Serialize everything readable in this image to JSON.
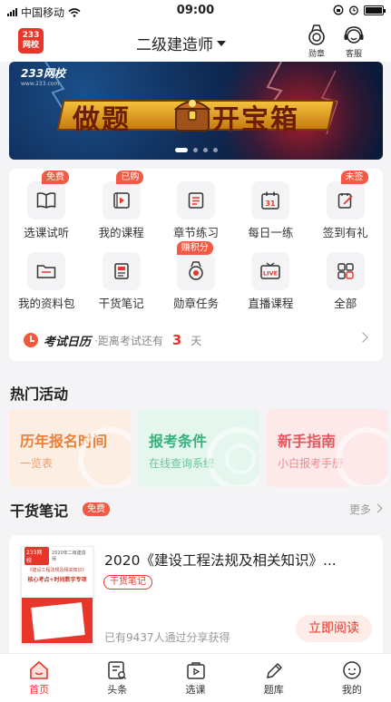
{
  "status_bar": {
    "carrier": "中国移动",
    "time": "09:00"
  },
  "navbar": {
    "logo_text_top": "233",
    "logo_text_bottom": "网校",
    "title": "二级建造师",
    "actions": [
      {
        "label": "勋章",
        "icon": "medal-icon"
      },
      {
        "label": "客服",
        "icon": "headset-icon"
      }
    ]
  },
  "banner": {
    "logo": "233网校",
    "logo_sub": "www.233.com",
    "slogan_left": "做题",
    "slogan_right": "开宝箱",
    "page_count": 4,
    "active_page": 1
  },
  "features": {
    "items": [
      {
        "label": "选课试听",
        "icon": "book-open-icon",
        "tag": "免费"
      },
      {
        "label": "我的课程",
        "icon": "play-video-icon",
        "tag": "已购"
      },
      {
        "label": "章节练习",
        "icon": "list-doc-icon",
        "tag": ""
      },
      {
        "label": "每日一练",
        "icon": "calendar-icon",
        "tag": "",
        "icon_text": "31"
      },
      {
        "label": "签到有礼",
        "icon": "sign-in-icon",
        "tag": "未签"
      },
      {
        "label": "我的资料包",
        "icon": "folder-icon",
        "tag": ""
      },
      {
        "label": "干货笔记",
        "icon": "notes-icon",
        "tag": ""
      },
      {
        "label": "勋章任务",
        "icon": "medal-task-icon",
        "tag": "赚积分"
      },
      {
        "label": "直播课程",
        "icon": "live-tv-icon",
        "tag": "",
        "icon_text": "LIVE"
      },
      {
        "label": "全部",
        "icon": "grid-all-icon",
        "tag": ""
      }
    ],
    "exam": {
      "title": "考试日历",
      "text": "·距离考试还有",
      "days": "3",
      "unit": "天"
    }
  },
  "hot": {
    "title": "热门活动",
    "items": [
      {
        "heading": "历年报名时间",
        "sub": "一览表",
        "bg": "#fdeee4",
        "color": "#e8823a"
      },
      {
        "heading": "报考条件",
        "sub": "在线查询系统",
        "bg": "#e4f6ee",
        "color": "#36b27a"
      },
      {
        "heading": "新手指南",
        "sub": "小白报考手册",
        "bg": "#fde8ea",
        "color": "#e8565e"
      }
    ]
  },
  "notes": {
    "title": "干货笔记",
    "free_tag": "免费",
    "more": "更多",
    "card": {
      "title": "2020《建设工程法规及相关知识》...",
      "tag": "干货笔记",
      "meta": "已有9437人通过分享获得",
      "button": "立即阅读",
      "cover_logo": "233网校",
      "cover_top": "2020年二级建造师",
      "cover_line1": "《建设工程法规及相关知识》",
      "cover_line2": "核心考点+时间数字专项"
    }
  },
  "tabbar": {
    "items": [
      {
        "label": "首页",
        "icon": "home-icon",
        "active": true
      },
      {
        "label": "头条",
        "icon": "news-icon",
        "active": false
      },
      {
        "label": "选课",
        "icon": "course-bag-icon",
        "active": false
      },
      {
        "label": "题库",
        "icon": "pencil-icon",
        "active": false
      },
      {
        "label": "我的",
        "icon": "profile-icon",
        "active": false
      }
    ]
  },
  "colors": {
    "brand": "#e8362b",
    "tag": "#f25a45",
    "background": "#f4f4f6"
  }
}
